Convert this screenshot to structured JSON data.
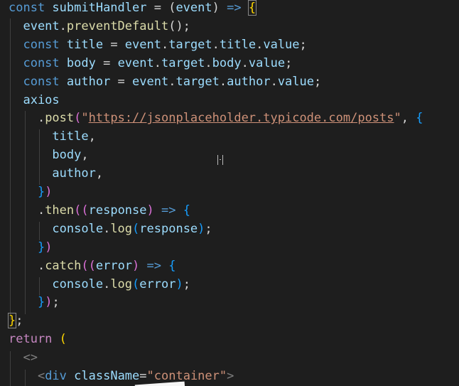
{
  "colors": {
    "background": "#1e1e1e",
    "keyword": "#569cd6",
    "control": "#c586c0",
    "variable": "#9cdcfe",
    "function": "#dcdcaa",
    "string": "#ce9178",
    "punctuation": "#d4d4d4",
    "bracket_yellow": "#ffd700",
    "bracket_purple": "#da70d6",
    "bracket_blue": "#179fff",
    "tag": "#808080",
    "tag_name": "#569cd6",
    "attribute": "#9cdcfe"
  },
  "code_lines": [
    [
      [
        "kw",
        "const "
      ],
      [
        "var",
        "submitHandler"
      ],
      [
        "p",
        " = ("
      ],
      [
        "var",
        "event"
      ],
      [
        "p",
        ") "
      ],
      [
        "kw",
        "=>"
      ],
      [
        "p",
        " "
      ],
      [
        "by",
        "{"
      ]
    ],
    [
      [
        "var",
        "  event"
      ],
      [
        "p",
        "."
      ],
      [
        "fn",
        "preventDefault"
      ],
      [
        "p",
        "();"
      ]
    ],
    [
      [
        "kw",
        "  const "
      ],
      [
        "var",
        "title"
      ],
      [
        "p",
        " = "
      ],
      [
        "var",
        "event"
      ],
      [
        "p",
        "."
      ],
      [
        "var",
        "target"
      ],
      [
        "p",
        "."
      ],
      [
        "var",
        "title"
      ],
      [
        "p",
        "."
      ],
      [
        "var",
        "value"
      ],
      [
        "p",
        ";"
      ]
    ],
    [
      [
        "kw",
        "  const "
      ],
      [
        "var",
        "body"
      ],
      [
        "p",
        " = "
      ],
      [
        "var",
        "event"
      ],
      [
        "p",
        "."
      ],
      [
        "var",
        "target"
      ],
      [
        "p",
        "."
      ],
      [
        "var",
        "body"
      ],
      [
        "p",
        "."
      ],
      [
        "var",
        "value"
      ],
      [
        "p",
        ";"
      ]
    ],
    [
      [
        "kw",
        "  const "
      ],
      [
        "var",
        "author"
      ],
      [
        "p",
        " = "
      ],
      [
        "var",
        "event"
      ],
      [
        "p",
        "."
      ],
      [
        "var",
        "target"
      ],
      [
        "p",
        "."
      ],
      [
        "var",
        "author"
      ],
      [
        "p",
        "."
      ],
      [
        "var",
        "value"
      ],
      [
        "p",
        ";"
      ]
    ],
    [
      [
        "var",
        "  axios"
      ]
    ],
    [
      [
        "p",
        "    ."
      ],
      [
        "fn",
        "post"
      ],
      [
        "bp",
        "("
      ],
      [
        "str",
        "\""
      ],
      [
        "url",
        "https://jsonplaceholder.typicode.com/posts"
      ],
      [
        "str",
        "\""
      ],
      [
        "p",
        ", "
      ],
      [
        "bb",
        "{"
      ]
    ],
    [
      [
        "var",
        "      title"
      ],
      [
        "p",
        ","
      ]
    ],
    [
      [
        "var",
        "      body"
      ],
      [
        "p",
        ","
      ]
    ],
    [
      [
        "var",
        "      author"
      ],
      [
        "p",
        ","
      ]
    ],
    [
      [
        "bb",
        "    }"
      ],
      [
        "bp",
        ")"
      ]
    ],
    [
      [
        "p",
        "    ."
      ],
      [
        "fn",
        "then"
      ],
      [
        "bp",
        "(("
      ],
      [
        "var",
        "response"
      ],
      [
        "bp",
        ")"
      ],
      [
        "p",
        " "
      ],
      [
        "kw",
        "=>"
      ],
      [
        "p",
        " "
      ],
      [
        "bb",
        "{"
      ]
    ],
    [
      [
        "var",
        "      console"
      ],
      [
        "p",
        "."
      ],
      [
        "fn",
        "log"
      ],
      [
        "bb",
        "("
      ],
      [
        "var",
        "response"
      ],
      [
        "bb",
        ")"
      ],
      [
        "p",
        ";"
      ]
    ],
    [
      [
        "bb",
        "    }"
      ],
      [
        "bp",
        ")"
      ]
    ],
    [
      [
        "p",
        "    ."
      ],
      [
        "fn",
        "catch"
      ],
      [
        "bp",
        "(("
      ],
      [
        "var",
        "error"
      ],
      [
        "bp",
        ")"
      ],
      [
        "p",
        " "
      ],
      [
        "kw",
        "=>"
      ],
      [
        "p",
        " "
      ],
      [
        "bb",
        "{"
      ]
    ],
    [
      [
        "var",
        "      console"
      ],
      [
        "p",
        "."
      ],
      [
        "fn",
        "log"
      ],
      [
        "bb",
        "("
      ],
      [
        "var",
        "error"
      ],
      [
        "bb",
        ")"
      ],
      [
        "p",
        ";"
      ]
    ],
    [
      [
        "bb",
        "    }"
      ],
      [
        "bp",
        ")"
      ],
      [
        "p",
        ";"
      ]
    ],
    [
      [
        "byb",
        "}"
      ],
      [
        "p",
        ";"
      ]
    ],
    [
      [
        "ctl",
        "return"
      ],
      [
        "p",
        " "
      ],
      [
        "by",
        "("
      ]
    ],
    [
      [
        "tag",
        "  <>"
      ]
    ],
    [
      [
        "tag",
        "    <"
      ],
      [
        "tagn",
        "div"
      ],
      [
        "p",
        " "
      ],
      [
        "attr",
        "className"
      ],
      [
        "p",
        "="
      ],
      [
        "str",
        "\"container\""
      ],
      [
        "tag",
        ">"
      ]
    ]
  ]
}
